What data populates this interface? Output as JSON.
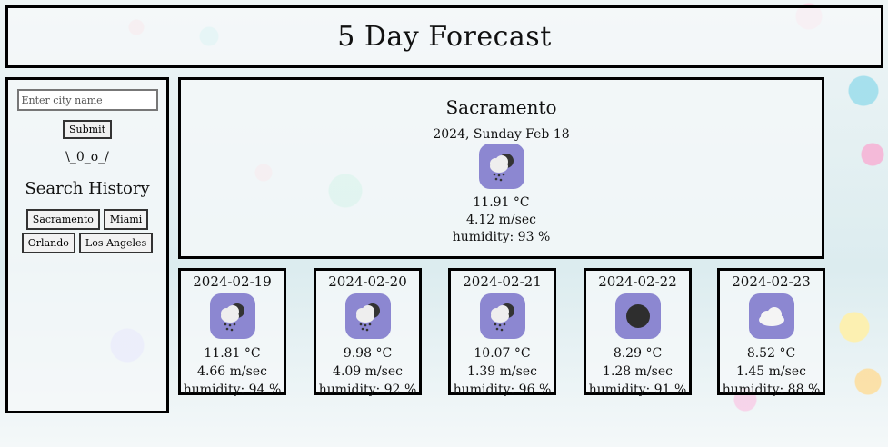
{
  "header": {
    "title": "5 Day Forecast"
  },
  "sidebar": {
    "input_placeholder": "Enter city name",
    "submit_label": "Submit",
    "shrug": "\\_0_o_/",
    "history_title": "Search History",
    "history": [
      "Sacramento",
      "Miami",
      "Orlando",
      "Los Angeles"
    ]
  },
  "current": {
    "city": "Sacramento",
    "date": "2024, Sunday Feb 18",
    "icon": "cloud-rain-icon",
    "temp": "11.91 °C",
    "wind": "4.12 m/sec",
    "humidity": "humidity: 93 %"
  },
  "forecast": [
    {
      "date": "2024-02-19",
      "icon": "cloud-rain-icon",
      "temp": "11.81 °C",
      "wind": "4.66 m/sec",
      "humidity": "humidity: 94 %"
    },
    {
      "date": "2024-02-20",
      "icon": "cloud-rain-icon",
      "temp": "9.98 °C",
      "wind": "4.09 m/sec",
      "humidity": "humidity: 92 %"
    },
    {
      "date": "2024-02-21",
      "icon": "cloud-rain-icon",
      "temp": "10.07 °C",
      "wind": "1.39 m/sec",
      "humidity": "humidity: 96 %"
    },
    {
      "date": "2024-02-22",
      "icon": "dark-circle-icon",
      "temp": "8.29 °C",
      "wind": "1.28 m/sec",
      "humidity": "humidity: 91 %"
    },
    {
      "date": "2024-02-23",
      "icon": "cloud-icon",
      "temp": "8.52 °C",
      "wind": "1.45 m/sec",
      "humidity": "humidity: 88 %"
    }
  ],
  "colors": {
    "icon_bg": "#8c87d1",
    "border": "#000000"
  }
}
